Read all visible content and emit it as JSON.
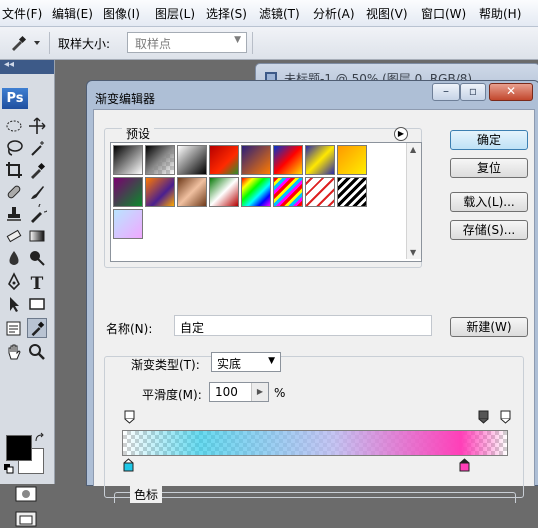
{
  "menu": [
    "文件(F)",
    "编辑(E)",
    "图像(I)",
    "图层(L)",
    "选择(S)",
    "滤镜(T)",
    "分析(A)",
    "视图(V)",
    "窗口(W)",
    "帮助(H)"
  ],
  "options_bar": {
    "sample_size_label": "取样大小:",
    "sample_size_value": "取样点"
  },
  "tools_panel": {
    "logo": "Ps"
  },
  "document_window": {
    "title": "未标题-1 @ 50% (图层 0, RGB/8)"
  },
  "dialog": {
    "title": "渐变编辑器",
    "presets_label": "预设",
    "buttons": {
      "ok": "确定",
      "reset": "复位",
      "load": "载入(L)...",
      "save": "存储(S)...",
      "new": "新建(W)"
    },
    "name_label": "名称(N):",
    "name_value": "自定",
    "gradient_type_label": "渐变类型(T):",
    "gradient_type_value": "实底",
    "smoothness_label": "平滑度(M):",
    "smoothness_value": "100",
    "smoothness_unit": "%",
    "color_stops_label": "色标",
    "gradient": {
      "start_color": "#1fc8e8",
      "end_color": "#ff3fb8",
      "opacity_start": 0,
      "opacity_end": 0
    }
  },
  "colors": {
    "foreground": "#000000",
    "background": "#ffffff",
    "default_button_border": "#3c7fb1"
  }
}
